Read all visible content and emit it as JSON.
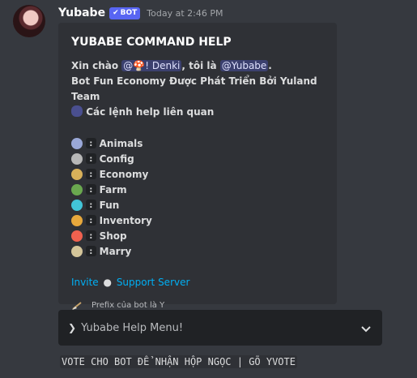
{
  "message": {
    "author": "Yubabe",
    "bot_tag": "BOT",
    "timestamp": "Today at 2:46 PM"
  },
  "embed": {
    "title": "YUBABE COMMAND HELP",
    "greeting": "Xin chào",
    "mention_user": "@🍄! Denki",
    "after_mention": ", tôi là",
    "mention_bot": "@Yubabe",
    "period": ".",
    "line2": "Bot Fun Economy Được Phát Triển Bởi Yuland Team",
    "line3": "Các lệnh help liên quan",
    "commands": [
      {
        "label": "Animals",
        "icon": "ghost-icon",
        "color": "#9aa8d8"
      },
      {
        "label": "Config",
        "icon": "gear-icon",
        "color": "#b7b7b7"
      },
      {
        "label": "Economy",
        "icon": "money-icon",
        "color": "#d9b15a"
      },
      {
        "label": "Farm",
        "icon": "seedling-icon",
        "color": "#6aa84f"
      },
      {
        "label": "Fun",
        "icon": "moon-icon",
        "color": "#42c5d8"
      },
      {
        "label": "Inventory",
        "icon": "box-icon",
        "color": "#e7a83c"
      },
      {
        "label": "Shop",
        "icon": "bag-icon",
        "color": "#f0614f"
      },
      {
        "label": "Marry",
        "icon": "ring-icon",
        "color": "#d4c59a"
      }
    ],
    "colon": ":",
    "link_invite": "Invite",
    "link_separator": "●",
    "link_support": "Support Server",
    "footer_text": "Prefix của bot là Y"
  },
  "select_menu": {
    "label": "Yubabe Help Menu!"
  },
  "vote_text": "VOTE CHO BOT ĐỂ NHẬN HỘP NGỌC | GÕ YVOTE",
  "colors": {
    "background": "#36393f",
    "embed": "#2f3136",
    "link": "#00aff4",
    "bot_tag": "#5865f2"
  }
}
